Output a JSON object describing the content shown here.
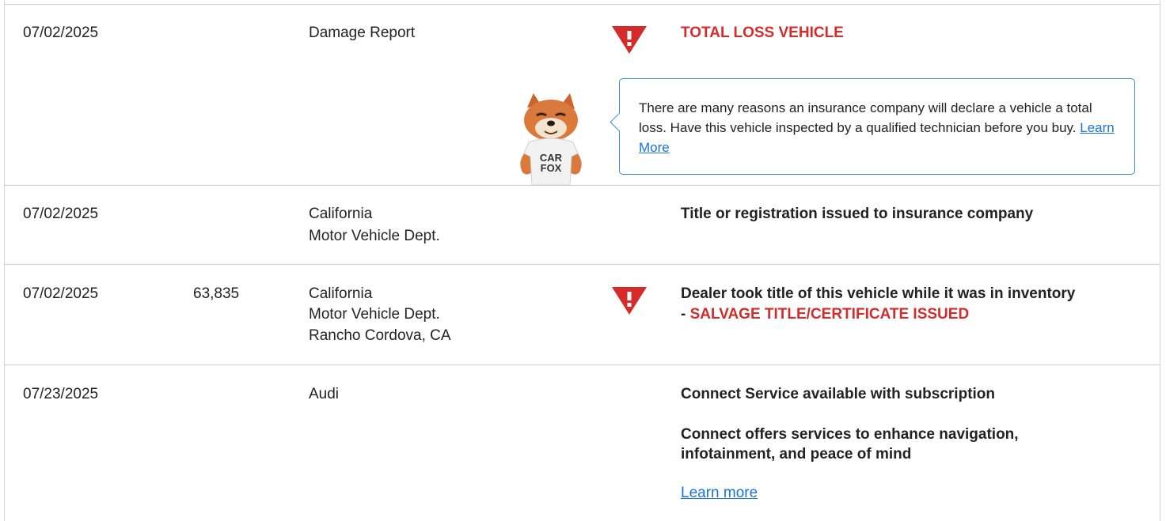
{
  "rows": [
    {
      "date": "07/02/2025",
      "mileage": "",
      "source": [
        "Damage Report"
      ],
      "alert": true,
      "alert_icon": "warning-triangle-icon",
      "detail": {
        "red_heading": "TOTAL LOSS VEHICLE"
      },
      "tooltip": {
        "text": "There are many reasons an insurance company will declare a vehicle a total loss. Have this vehicle inspected by a qualified technician before you buy. ",
        "link": "Learn More"
      },
      "mascot": {
        "shirt_line1": "CAR",
        "shirt_line2": "FOX"
      }
    },
    {
      "date": "07/02/2025",
      "mileage": "",
      "source": [
        "California",
        "Motor Vehicle Dept."
      ],
      "alert": false,
      "detail": {
        "bold": "Title or registration issued to insurance company"
      }
    },
    {
      "date": "07/02/2025",
      "mileage": "63,835",
      "source": [
        "California",
        "Motor Vehicle Dept.",
        "Rancho Cordova, CA"
      ],
      "alert": true,
      "alert_icon": "warning-triangle-icon",
      "detail": {
        "bold": "Dealer took title of this vehicle while it was in inventory",
        "prefix": "- ",
        "red": "SALVAGE TITLE/CERTIFICATE ISSUED"
      }
    },
    {
      "date": "07/23/2025",
      "mileage": "",
      "source": [
        "Audi"
      ],
      "alert": false,
      "detail": {
        "bold": "Connect Service available with subscription",
        "bold2_line1": "Connect offers services to enhance navigation,",
        "bold2_line2": "infotainment, and peace of mind",
        "link": "Learn more"
      }
    }
  ],
  "colors": {
    "alert_red": "#d52b2b",
    "link_blue": "#1a73d9",
    "tooltip_border": "#3a8bd9"
  }
}
